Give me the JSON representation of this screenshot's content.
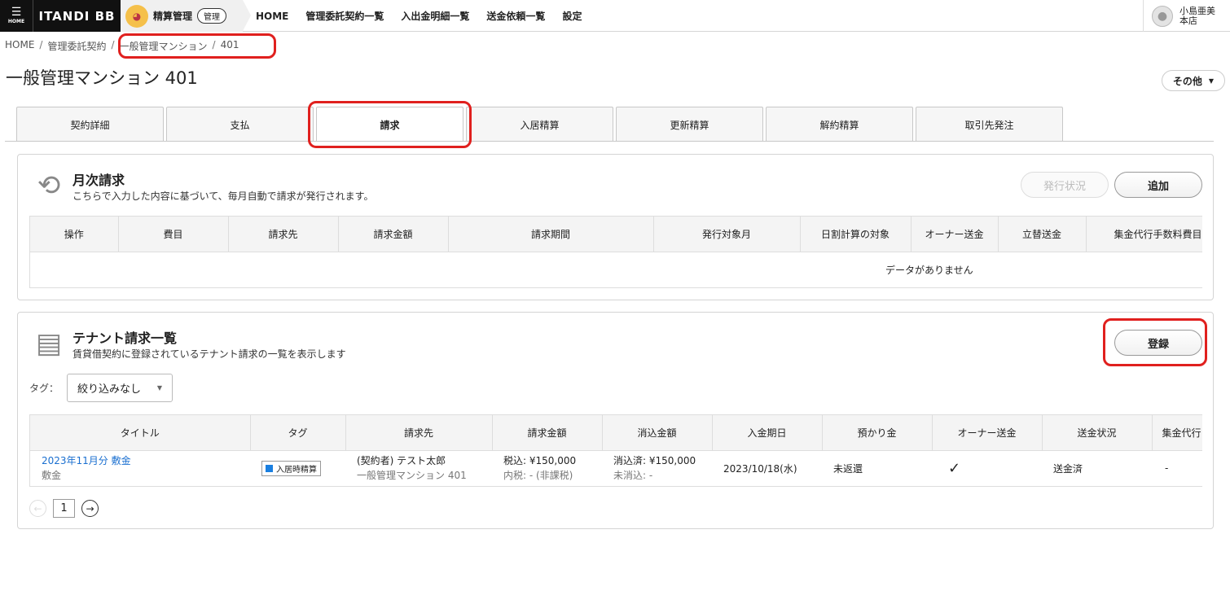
{
  "header": {
    "home_icon": "hamburger-icon",
    "home_label": "HOME",
    "brand": "ITANDI BB",
    "app_name": "精算管理",
    "app_badge": "管理",
    "nav": [
      "HOME",
      "管理委託契約一覧",
      "入出金明細一覧",
      "送金依頼一覧",
      "設定"
    ],
    "user_name": "小島亜美",
    "user_branch": "本店"
  },
  "breadcrumb": [
    "HOME",
    "管理委託契約",
    "一般管理マンション",
    "401"
  ],
  "page": {
    "title": "一般管理マンション 401",
    "other_button": "その他"
  },
  "tabs": [
    "契約詳細",
    "支払",
    "請求",
    "入居精算",
    "更新精算",
    "解約精算",
    "取引先発注"
  ],
  "active_tab": "請求",
  "monthly": {
    "title": "月次請求",
    "subtitle": "こちらで入力した内容に基づいて、毎月自動で請求が発行されます。",
    "status_button": "発行状況",
    "add_button": "追加",
    "columns": [
      "操作",
      "費目",
      "請求先",
      "請求金額",
      "請求期間",
      "発行対象月",
      "日割計算の対象",
      "オーナー送金",
      "立替送金",
      "集金代行手数料費目"
    ],
    "empty": "データがありません"
  },
  "tenant": {
    "title": "テナント請求一覧",
    "subtitle": "賃貸借契約に登録されているテナント請求の一覧を表示します",
    "register_button": "登録",
    "tag_label": "タグ：",
    "tag_filter": "絞り込みなし",
    "columns": [
      "タイトル",
      "タグ",
      "請求先",
      "請求金額",
      "消込金額",
      "入金期日",
      "預かり金",
      "オーナー送金",
      "送金状況",
      "集金代行"
    ],
    "rows": [
      {
        "title": "2023年11月分 敷金",
        "subtitle": "敷金",
        "tag": "入居時精算",
        "payer": "(契約者) テスト太郎",
        "payer_sub": "一般管理マンション 401",
        "amount": "税込: ¥150,000",
        "amount_sub": "内税: - (非課税)",
        "cleared": "消込済: ¥150,000",
        "cleared_sub": "未消込: -",
        "due_date": "2023/10/18(水)",
        "deposit": "未返還",
        "owner_remit": "✓",
        "remit_status": "送金済",
        "collection": "-"
      }
    ],
    "page": "1"
  },
  "colors": {
    "accent_link": "#1a6fd0",
    "highlight": "#e0201e",
    "tag_color": "#1a7fe0"
  }
}
